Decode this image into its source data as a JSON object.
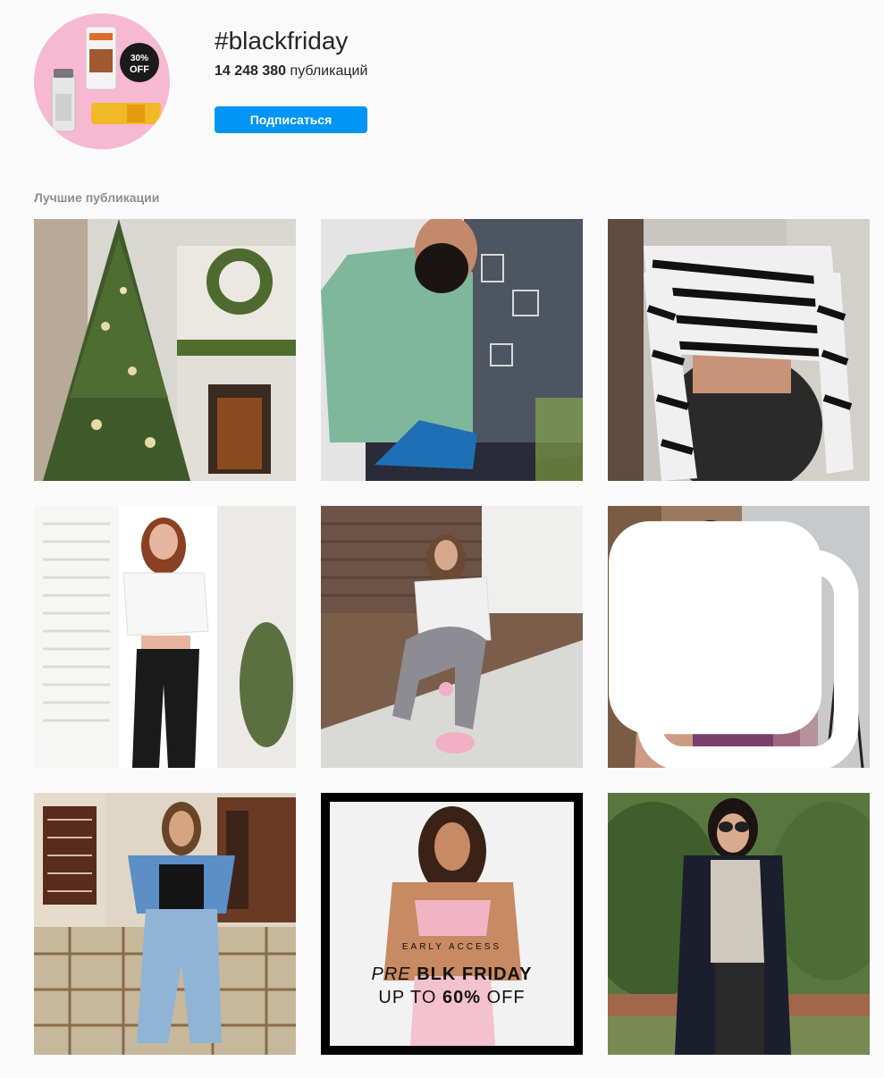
{
  "header": {
    "hashtag": "#blackfriday",
    "post_count_number": "14 248 380",
    "post_count_label": "публикаций",
    "follow_label": "Подписаться",
    "avatar_badge": {
      "pct": "30%",
      "off": "OFF"
    }
  },
  "top_posts": {
    "title": "Лучшие публикации"
  },
  "promo": {
    "early_access": "EARLY ACCESS",
    "pre": "PRE",
    "blk_friday": "BLK FRIDAY",
    "up_to": "UP TO",
    "pct": "60%",
    "off": "OFF"
  },
  "colors": {
    "accent": "#0095f6",
    "avatar_bg": "#f7b8d2"
  }
}
